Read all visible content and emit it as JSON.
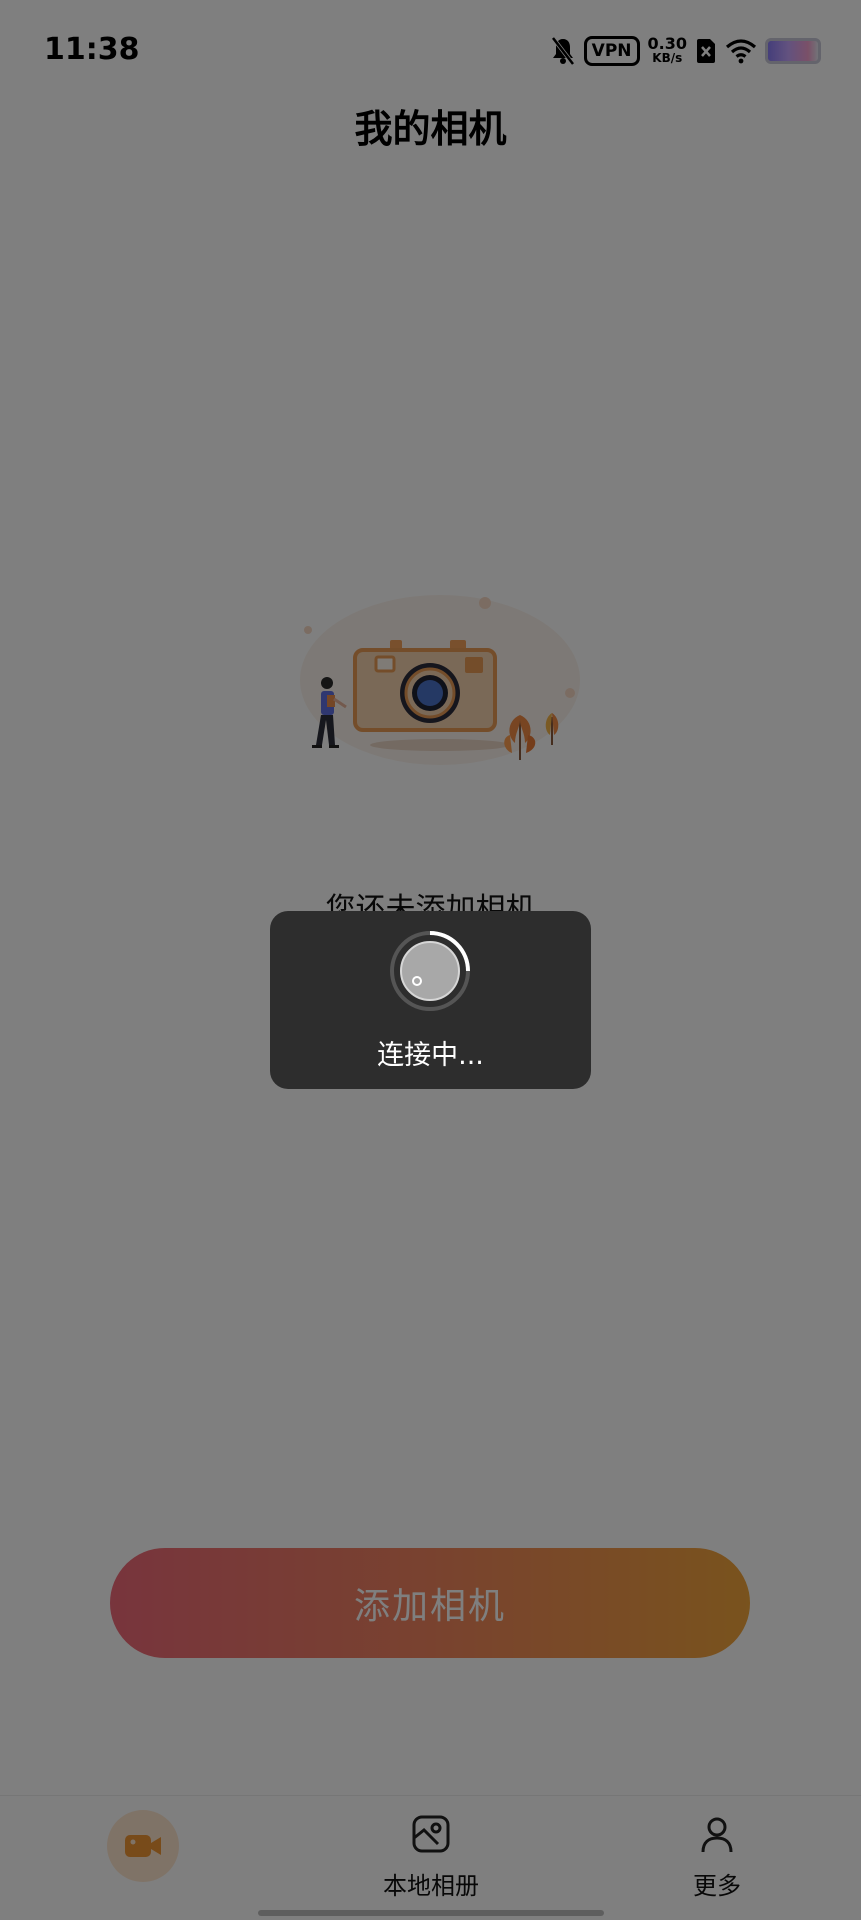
{
  "status_bar": {
    "time": "11:38",
    "vpn_label": "VPN",
    "net_speed_value": "0.30",
    "net_speed_unit": "KB/s"
  },
  "header": {
    "title": "我的相机"
  },
  "empty_state": {
    "message": "您还未添加相机"
  },
  "actions": {
    "add_camera_label": "添加相机"
  },
  "bottom_nav": {
    "items": [
      {
        "label": "",
        "icon": "video-camera-icon",
        "active": true
      },
      {
        "label": "本地相册",
        "icon": "album-icon",
        "active": false
      },
      {
        "label": "更多",
        "icon": "person-icon",
        "active": false
      }
    ]
  },
  "loading": {
    "message": "连接中..."
  },
  "colors": {
    "accent": "#f3a63b",
    "button_gradient_start": "#f06a7a",
    "button_gradient_end": "#f3a63b",
    "dialog_bg": "#2d2d2d"
  }
}
